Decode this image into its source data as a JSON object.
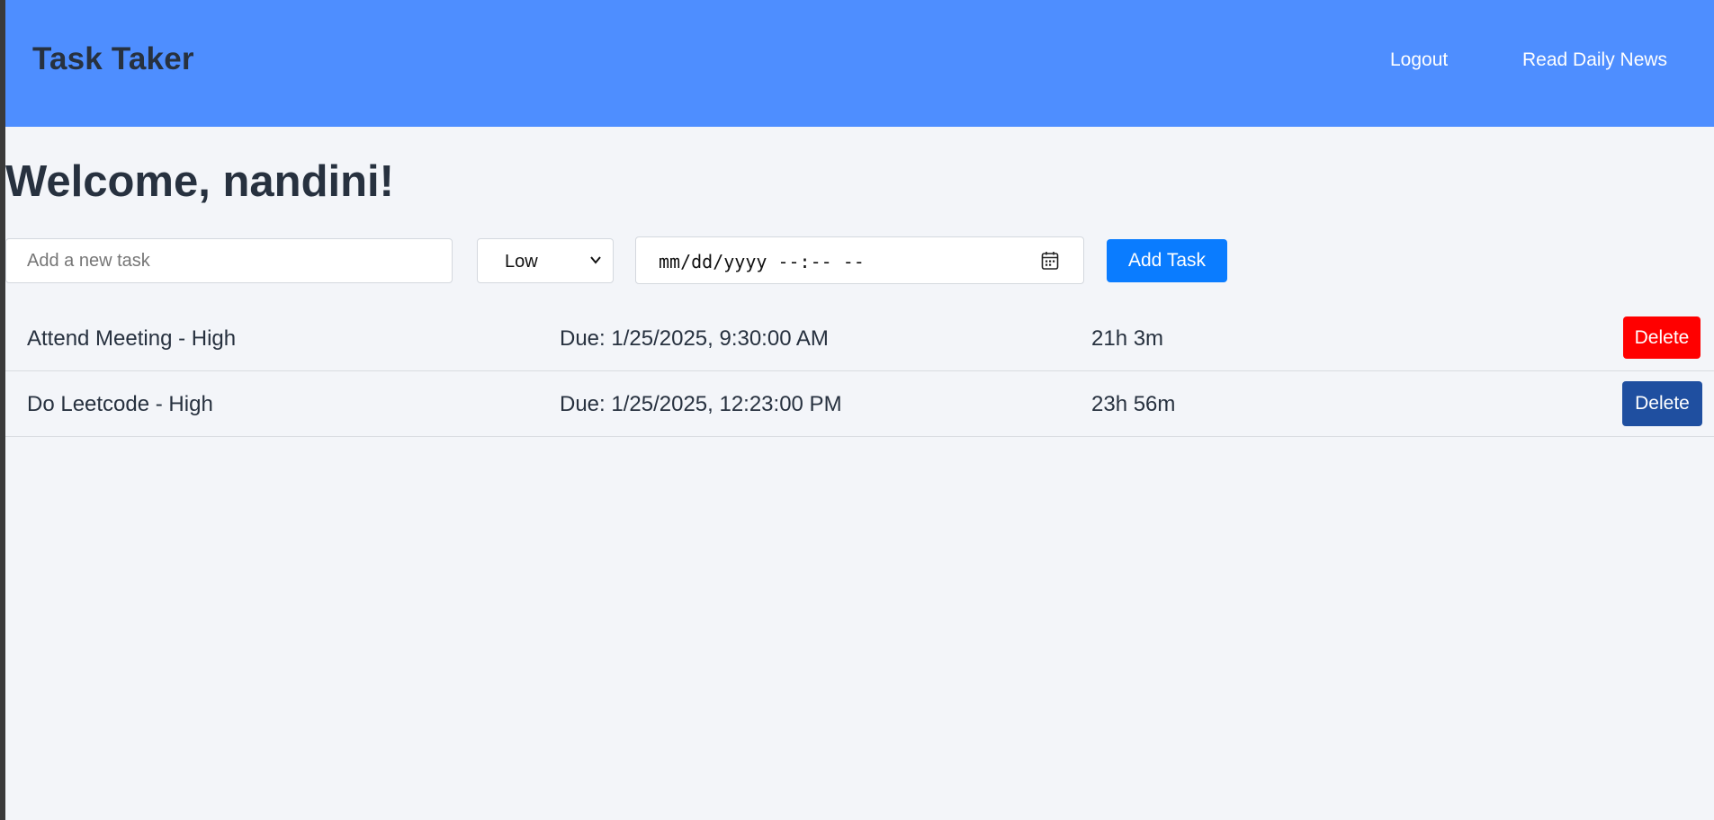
{
  "header": {
    "brand": "Task Taker",
    "nav": {
      "logout": "Logout",
      "news": "Read Daily News"
    }
  },
  "welcome": "Welcome, nandini!",
  "form": {
    "task_placeholder": "Add a new task",
    "task_value": "",
    "priority_selected": "Low",
    "datetime_placeholder": "mm/dd/yyyy --:-- --",
    "add_button": "Add Task"
  },
  "tasks": [
    {
      "name": "Attend Meeting - High",
      "due": "Due: 1/25/2025, 9:30:00 AM",
      "remaining": "21h 3m",
      "delete_label": "Delete",
      "delete_color": "#ff0000"
    },
    {
      "name": "Do Leetcode - High",
      "due": "Due: 1/25/2025, 12:23:00 PM",
      "remaining": "23h 56m",
      "delete_label": "Delete",
      "delete_color": "#1f4fa0"
    }
  ],
  "colors": {
    "header_bg": "#4e8eff",
    "primary_button": "#0a7cff",
    "page_bg": "#f3f5f9"
  },
  "icons": {
    "priority_dropdown": "chevron-down-icon",
    "date_picker": "calendar-icon"
  }
}
